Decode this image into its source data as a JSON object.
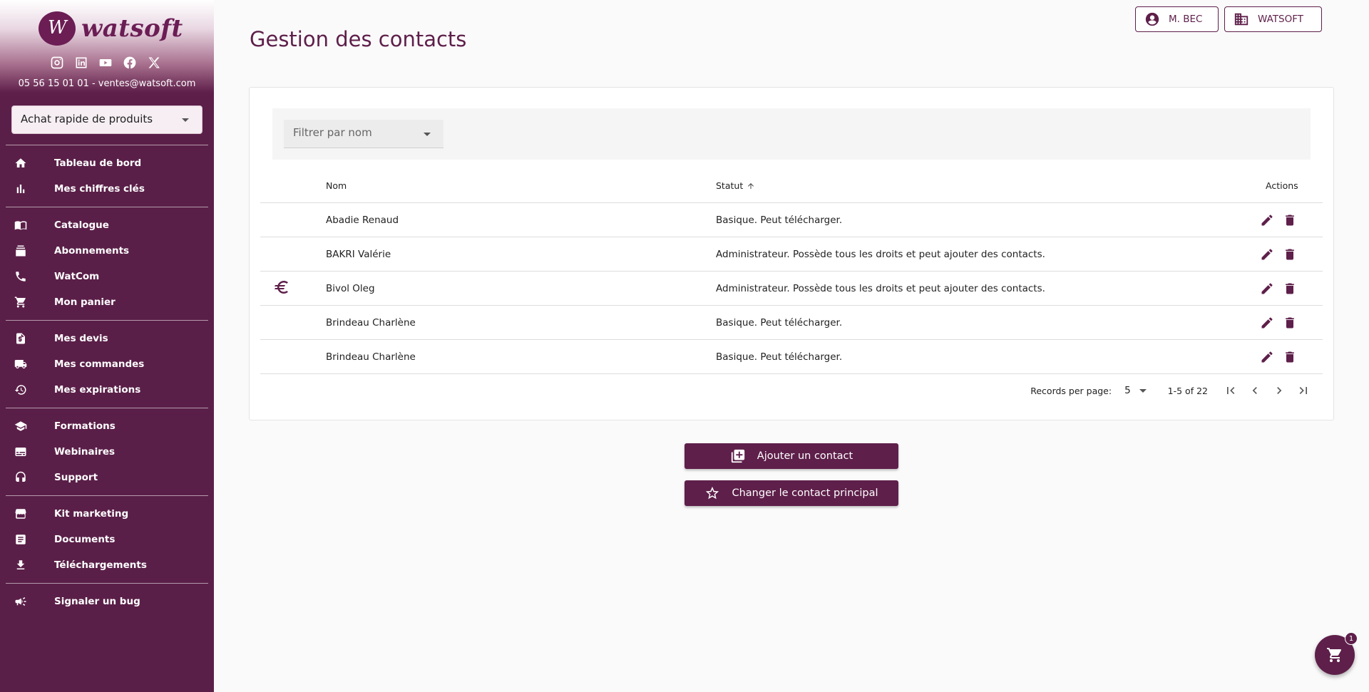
{
  "brand": {
    "name": "watsoft",
    "contact": "05 56 15 01 01 - ventes@watsoft.com",
    "accent": "#5e1f4a"
  },
  "socials": [
    "instagram-icon",
    "linkedin-icon",
    "youtube-icon",
    "facebook-icon",
    "x-icon"
  ],
  "quick_buy": {
    "value": "Achat rapide de produits"
  },
  "sidebar": {
    "items": [
      {
        "label": "Tableau de bord",
        "icon": "home-icon"
      },
      {
        "label": "Mes chiffres clés",
        "icon": "bar-chart-icon"
      },
      {
        "label": "Catalogue",
        "icon": "book-icon"
      },
      {
        "label": "Abonnements",
        "icon": "subscriptions-icon"
      },
      {
        "label": "WatCom",
        "icon": "phone-icon"
      },
      {
        "label": "Mon panier",
        "icon": "cart-icon"
      },
      {
        "label": "Mes devis",
        "icon": "quote-doc-icon"
      },
      {
        "label": "Mes commandes",
        "icon": "truck-icon"
      },
      {
        "label": "Mes expirations",
        "icon": "history-icon"
      },
      {
        "label": "Formations",
        "icon": "school-icon"
      },
      {
        "label": "Webinaires",
        "icon": "video-card-icon"
      },
      {
        "label": "Support",
        "icon": "headset-icon"
      },
      {
        "label": "Kit marketing",
        "icon": "storefront-icon"
      },
      {
        "label": "Documents",
        "icon": "document-icon"
      },
      {
        "label": "Téléchargements",
        "icon": "download-icon"
      },
      {
        "label": "Signaler un bug",
        "icon": "campaign-icon"
      }
    ]
  },
  "header": {
    "title": "Gestion des contacts",
    "user_label": "M. BEC",
    "company_label": "WATSOFT"
  },
  "filter": {
    "placeholder": "Filtrer par nom"
  },
  "table": {
    "columns": {
      "name": "Nom",
      "status": "Statut",
      "actions": "Actions"
    },
    "rows": [
      {
        "name": "Abadie Renaud",
        "status": "Basique. Peut télécharger.",
        "icon": ""
      },
      {
        "name": "BAKRI Valérie",
        "status": "Administrateur. Possède tous les droits et peut ajouter des contacts.",
        "icon": ""
      },
      {
        "name": "Bivol Oleg",
        "status": "Administrateur. Possède tous les droits et peut ajouter des contacts.",
        "icon": "euro-icon"
      },
      {
        "name": "Brindeau Charlène",
        "status": "Basique. Peut télécharger.",
        "icon": ""
      },
      {
        "name": "Brindeau Charlène",
        "status": "Basique. Peut télécharger.",
        "icon": ""
      }
    ]
  },
  "pagination": {
    "rpp_label": "Records per page:",
    "rpp_value": "5",
    "range": "1-5 of 22"
  },
  "actions": {
    "add_contact": "Ajouter un contact",
    "change_main": "Changer le contact principal"
  },
  "cart": {
    "count": "1"
  }
}
